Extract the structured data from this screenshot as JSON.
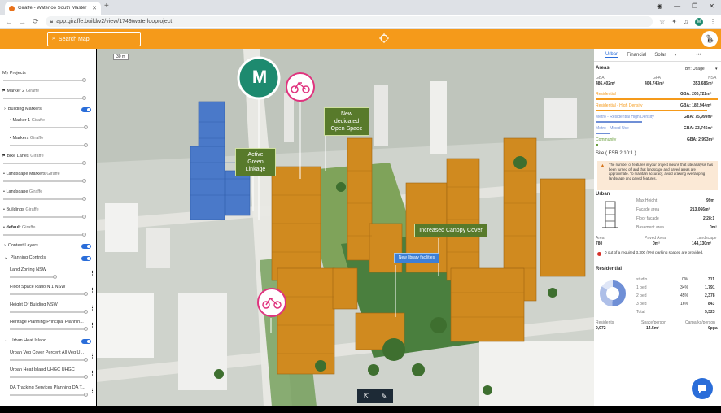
{
  "browser": {
    "tab_title": "Giraffe - Waterloo South Master",
    "url": "app.giraffe.build/v2/view/1749/waterlooproject",
    "avatar_letter": "M"
  },
  "header": {
    "search_placeholder": "Search Map"
  },
  "left_panel": {
    "my_projects": "My Projects",
    "marker2": "Marker 2",
    "marker2_sub": "Giraffe",
    "building_markers": "Building Markers",
    "marker1": "Marker 1",
    "marker1_sub": "Giraffe",
    "markers": "Markers",
    "markers_sub": "Giraffe",
    "bike_lanes": "Bike Lanes",
    "bike_lanes_sub": "Giraffe",
    "landscape_markers": "Landscape Markers",
    "landscape_markers_sub": "Giraffe",
    "landscape": "Landscape",
    "landscape_sub": "Giraffe",
    "buildings": "Buildings",
    "buildings_sub": "Giraffe",
    "default": "default",
    "default_sub": "Giraffe",
    "context_layers": "Context Layers",
    "planning_controls": "Planning Controls",
    "land_zoning": "Land Zoning NSW",
    "floor_space": "Floor Space Ratio N 1 NSW",
    "height_building": "Height Of Building NSW",
    "heritage": "Heritage Planning Principal Plannin...",
    "urban_heat": "Urban Heat Island",
    "urban_veg": "Urban Veg Cover Percent All Veg U...",
    "urban_heat_uhgc": "Urban Heat Island UHGC UHGC",
    "da_tracking": "DA Tracking Services Planning DA T..."
  },
  "map": {
    "scale_label": "30 m",
    "marker_letter": "M",
    "callout_green": "Active Green\nLinkage",
    "callout_open": "New dedicated\nOpen Space",
    "callout_canopy": "Increased Canopy Cover",
    "callout_library": "New library facilities",
    "tool_icons": [
      "cursor-icon",
      "ruler-icon"
    ]
  },
  "right_panel": {
    "tabs": [
      "Urban",
      "Financial",
      "Solar"
    ],
    "areas_title": "Areas",
    "by_label": "BY: Usage",
    "gba_label": "GBA",
    "gba_value": "486,402m²",
    "gfa_label": "GFA",
    "gfa_value": "404,743m²",
    "nsa_label": "NSA",
    "nsa_value": "353,686m²",
    "rows": [
      {
        "name": "Residential",
        "value": "GBA: 200,722m²",
        "color": "#f59a1a"
      },
      {
        "name": "Residential - High Density",
        "value": "GBA: 182,944m²",
        "color": "#f59a1a"
      },
      {
        "name": "Metro - Residential High Density",
        "value": "GBA: 75,999m²",
        "color": "#6f8fd6"
      },
      {
        "name": "Metro - Mixed Use",
        "value": "GBA: 23,745m²",
        "color": "#6f8fd6"
      },
      {
        "name": "Community",
        "value": "GBA: 2,993m²",
        "color": "#6a9e3d"
      }
    ],
    "site_label": "Site ( FSR 2.10:1 )",
    "warning_text": "The number of features in your project means that site analysis has been turned off and that landscape and paved areas are approximate. To maintain accuracy, avoid drawing overlapping landscape and paved features.",
    "urban_title": "Urban",
    "max_height_label": "Max Height",
    "max_height_value": "99m",
    "facade_area_label": "Facade area",
    "facade_area_value": "213,066m²",
    "floor_facade_label": "Floor facade",
    "floor_facade_value": "2.28:1",
    "basement_label": "Basement area",
    "basement_value": "0m²",
    "area_label": "Area",
    "area_value": "780",
    "paved_label": "Paved Area",
    "paved_value": "0m²",
    "landscape_label": "Landscape",
    "landscape_value": "144,130m²",
    "parking_text": "0 out of a required 3,300 (0%) parking spaces are provided.",
    "residential_title": "Residential",
    "res_rows": [
      {
        "name": "studio",
        "pct": "0%",
        "count": "311"
      },
      {
        "name": "1 bed",
        "pct": "34%",
        "count": "1,791"
      },
      {
        "name": "2 bed",
        "pct": "45%",
        "count": "2,378"
      },
      {
        "name": "3 bed",
        "pct": "16%",
        "count": "843"
      },
      {
        "name": "Total",
        "pct": "",
        "count": "5,323"
      }
    ],
    "residents_label": "Residents",
    "residents_value": "9,972",
    "space_person_label": "Space/person",
    "space_person_value": "14.5m²",
    "carparks_label": "Carparks/person",
    "carparks_value": "0ppa"
  },
  "colors": {
    "accent": "#f59a1a",
    "building": "#d08a1f",
    "metro": "#4a79c9",
    "green": "#587a2b",
    "bike": "#e0337e"
  }
}
